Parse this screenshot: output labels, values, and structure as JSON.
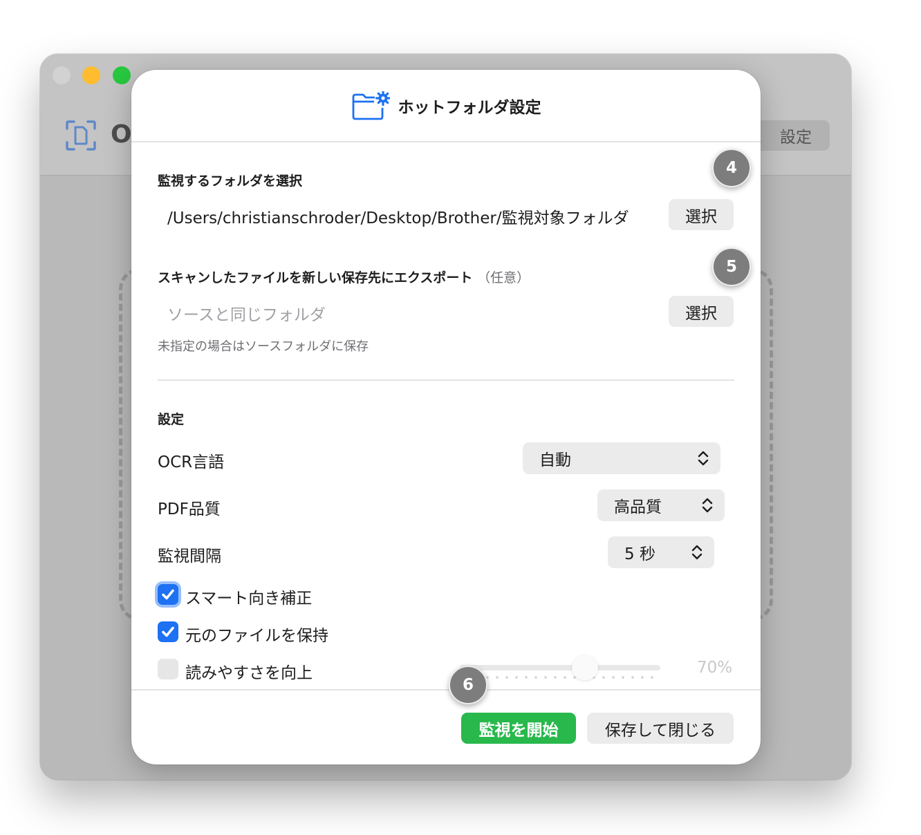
{
  "background_app": {
    "title": "O",
    "settings_label": "設定"
  },
  "sheet": {
    "title": "ホットフォルダ設定",
    "watch_folder": {
      "label": "監視するフォルダを選択",
      "path": "/Users/christianschroder/Desktop/Brother/監視対象フォルダ",
      "choose_label": "選択"
    },
    "export_folder": {
      "label": "スキャンしたファイルを新しい保存先にエクスポート",
      "optional_label": "（任意）",
      "placeholder": "ソースと同じフォルダ",
      "choose_label": "選択",
      "hint": "未指定の場合はソースフォルダに保存"
    },
    "settings": {
      "heading": "設定",
      "ocr_language": {
        "label": "OCR言語",
        "value": "自動"
      },
      "pdf_quality": {
        "label": "PDF品質",
        "value": "高品質"
      },
      "watch_interval": {
        "label": "監視間隔",
        "value": "5 秒"
      },
      "smart_orientation": {
        "label": "スマート向き補正",
        "checked": true
      },
      "keep_original": {
        "label": "元のファイルを保持",
        "checked": true
      },
      "improve_readability": {
        "label": "読みやすさを向上",
        "checked": false,
        "level": 0.7,
        "level_label": "70%"
      }
    },
    "footer": {
      "start_label": "監視を開始",
      "save_close_label": "保存して閉じる"
    }
  },
  "markers": [
    "4",
    "5",
    "6"
  ],
  "colors": {
    "accent": "#1d71f2",
    "start_button": "#28b84c",
    "marker": "#7d7d7d"
  }
}
